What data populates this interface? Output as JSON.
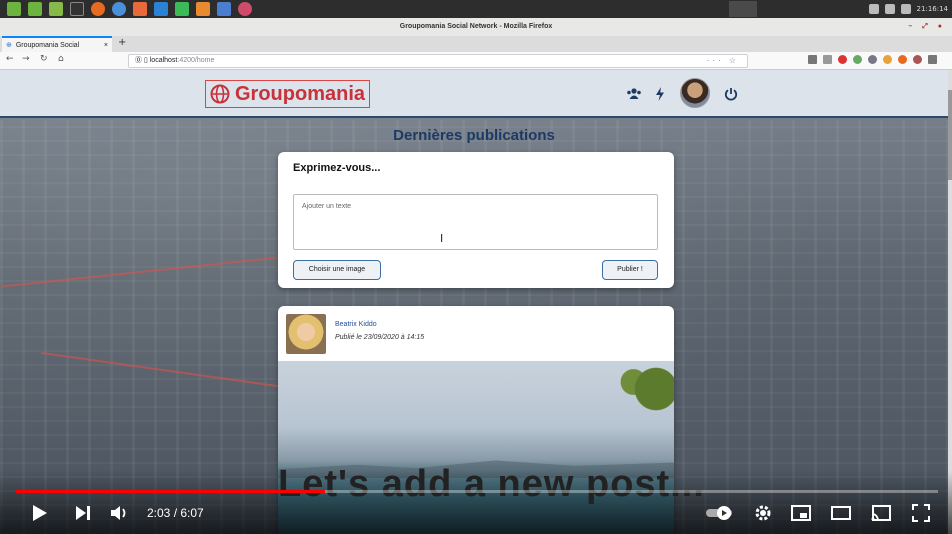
{
  "window": {
    "title": "Groupomania Social Network - Mozilla Firefox"
  },
  "taskbar": {
    "clock": "21:16:14"
  },
  "browser": {
    "tab_label": "Groupomania Social",
    "url_host": "localhost",
    "url_path": ":4200/home"
  },
  "app": {
    "logo_text": "Groupomania",
    "page_title": "Dernières publications",
    "compose": {
      "title": "Exprimez-vous...",
      "placeholder": "Ajouter un texte",
      "choose_image_label": "Choisir une image",
      "publish_label": "Publier !"
    },
    "post": {
      "author": "Beatrix Kiddo",
      "date": "Publié le 23/09/2020 à 14:15"
    }
  },
  "video": {
    "overlay": "Let's add a new post...",
    "time": "2:03 / 6:07",
    "progress_fraction": 0.335
  },
  "colors": {
    "brand_red": "#c8323a",
    "header_navy": "#1d3a63",
    "progress_red": "#ff0000"
  }
}
